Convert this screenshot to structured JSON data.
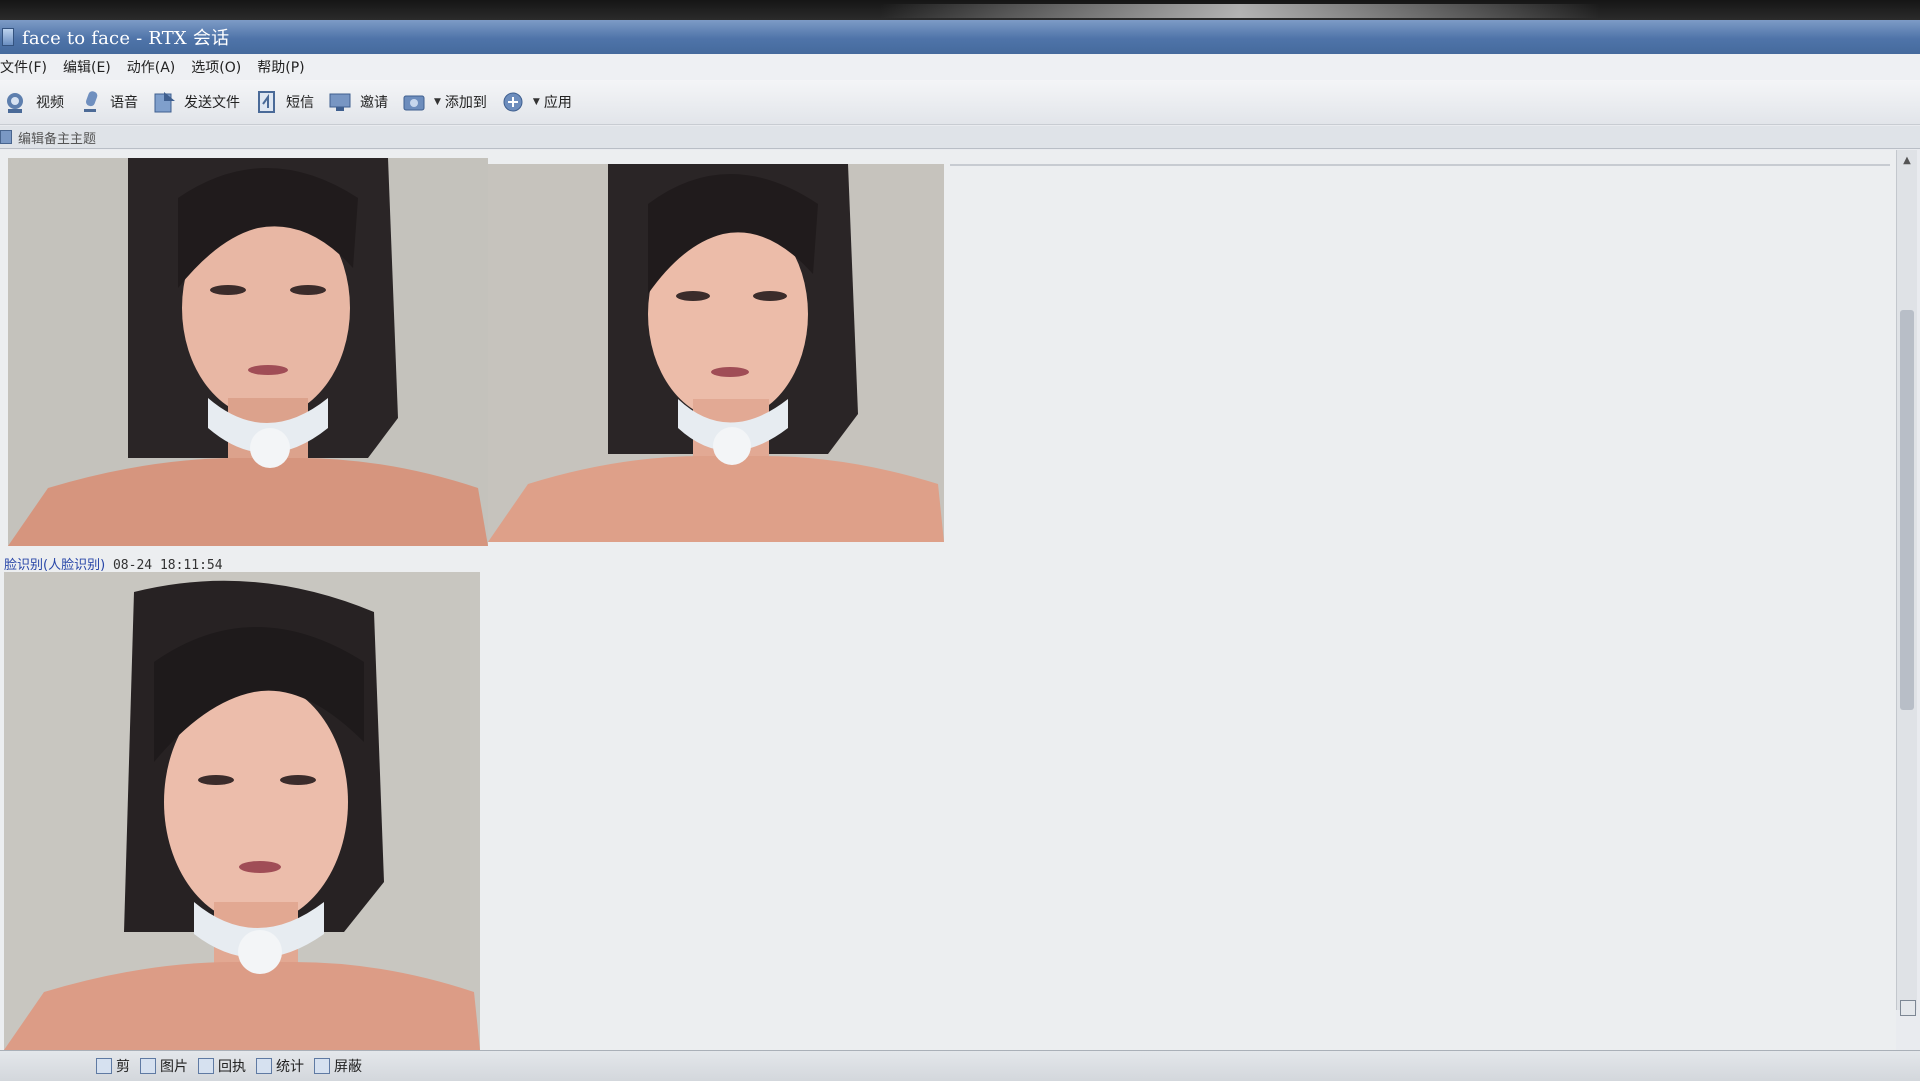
{
  "window": {
    "title": "face to face - RTX 会话"
  },
  "menu": {
    "items": [
      {
        "label": "文件(F)"
      },
      {
        "label": "编辑(E)"
      },
      {
        "label": "动作(A)"
      },
      {
        "label": "选项(O)"
      },
      {
        "label": "帮助(P)"
      }
    ]
  },
  "toolbar": {
    "video": "视频",
    "voice": "语音",
    "send_file": "发送文件",
    "sms": "短信",
    "invite": "邀请",
    "add_to": "添加到",
    "apps": "应用"
  },
  "subject": {
    "label": "编辑备主主题"
  },
  "chat": {
    "message_sender": "脸识别(人脸识别)",
    "message_time": "08-24 18:11:54"
  },
  "input_toolbar": {
    "items": [
      {
        "label": "剪"
      },
      {
        "label": "图片"
      },
      {
        "label": "回执"
      },
      {
        "label": "统计"
      },
      {
        "label": "屏蔽"
      }
    ]
  },
  "colors": {
    "titlebar": "#4f74a9",
    "sender_link": "#2846a8",
    "chat_background": "#eceef0"
  }
}
